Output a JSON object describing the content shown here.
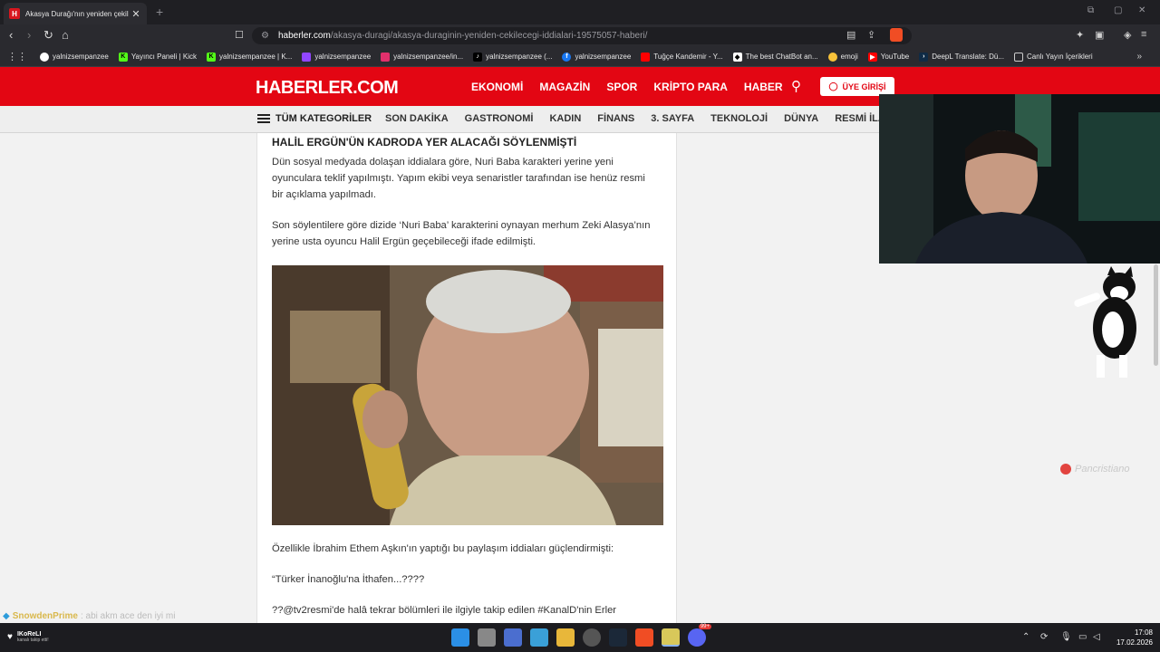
{
  "browser": {
    "tab_title": "Akasya Durağı'nın yeniden çekil",
    "tab_favicon": "H",
    "url_domain": "haberler.com",
    "url_path": "/akasya-duragi/akasya-duraginin-yeniden-cekilecegi-iddialari-19575057-haberi/",
    "bookmarks": [
      {
        "label": "yalnizsempanzee",
        "icon": "google-icon",
        "color": "#ffffff"
      },
      {
        "label": "Yayıncı Paneli | Kick",
        "icon": "kick-icon",
        "color": "#53fc18"
      },
      {
        "label": "yalnizsempanzee | K...",
        "icon": "kick-icon",
        "color": "#53fc18"
      },
      {
        "label": "yalnizsempanzee",
        "icon": "twitch-icon",
        "color": "#9146ff"
      },
      {
        "label": "yalnizsempanzee/in...",
        "icon": "instagram-icon",
        "color": "#e1306c"
      },
      {
        "label": "yalnizsempanzee (...",
        "icon": "tiktok-icon",
        "color": "#000000"
      },
      {
        "label": "yalnizsempanzee",
        "icon": "facebook-icon",
        "color": "#1877f2"
      },
      {
        "label": "Tuğçe Kandemir - Y...",
        "icon": "youtube-icon",
        "color": "#ff0000"
      },
      {
        "label": "The best ChatBot an...",
        "icon": "chatbot-icon",
        "color": "#ffffff"
      },
      {
        "label": "emoji",
        "icon": "emoji-icon",
        "color": "#f7c23a"
      },
      {
        "label": "YouTube",
        "icon": "youtube-icon",
        "color": "#ff0000"
      },
      {
        "label": "DeepL Translate: Dü...",
        "icon": "deepl-icon",
        "color": "#0f2b46"
      },
      {
        "label": "Canlı Yayın İçerikleri",
        "icon": "folder-icon",
        "color": "#cccccc"
      }
    ]
  },
  "site": {
    "logo": "HABERLER.COM",
    "main_nav": [
      "EKONOMİ",
      "MAGAZİN",
      "SPOR",
      "KRİPTO PARA",
      "HABER"
    ],
    "login": "ÜYE GİRİŞİ",
    "category_menu": "TÜM KATEGORİLER",
    "categories": [
      "SON DAKİKA",
      "GASTRONOMİ",
      "KADIN",
      "FİNANS",
      "3. SAYFA",
      "TEKNOLOJİ",
      "DÜNYA",
      "RESMİ İLANLAR"
    ]
  },
  "article": {
    "headline": "HALİL ERGÜN'ÜN KADRODA YER ALACAĞI SÖYLENMİŞTİ",
    "p1": "Dün sosyal medyada dolaşan iddialara göre, Nuri Baba karakteri yerine yeni oyunculara teklif yapılmıştı. Yapım ekibi veya senaristler tarafından ise henüz resmi bir açıklama yapılmadı.",
    "p2": "Son söylentilere göre dizide ‘Nuri Baba’ karakterini oynayan merhum Zeki Alasya’nın yerine usta oyuncu Halil Ergün geçebileceği ifade edilmişti.",
    "p3": "Özellikle İbrahim Ethem Aşkın'ın yaptığı bu paylaşım iddiaları güçlendirmişti:",
    "p4": "“Türker İnanoğlu'na İthafen...????",
    "p5": "??@tv2resmi'de halâ tekrar bölümleri ile ilgiyle takip edilen #KanalD'nin Erler"
  },
  "overlay": {
    "chat_user": "SnowdenPrime",
    "chat_message": ": abi akm ace den iyi mi",
    "notif_title": "IKoReLI",
    "notif_sub": "kanalı takip etti!",
    "watermark": "Pancristiano"
  },
  "taskbar": {
    "time": "17:08",
    "date": "17.02.2026",
    "discord_badge": "99+"
  }
}
